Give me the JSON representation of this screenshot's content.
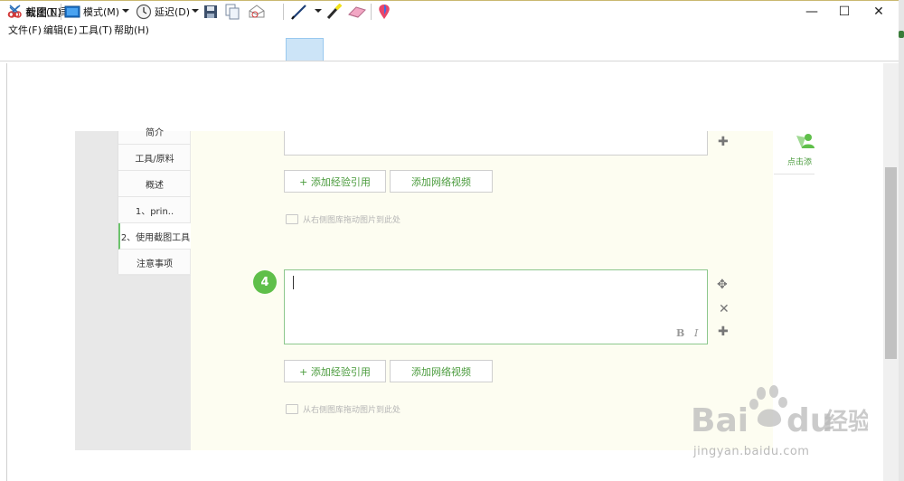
{
  "window": {
    "title": "截图工具",
    "controls": {
      "minimize": "—",
      "maximize": "☐",
      "close": "✕"
    }
  },
  "menu": [
    "文件(F)",
    "编辑(E)",
    "工具(T)",
    "帮助(H)"
  ],
  "toolbar": {
    "new_label": "新建(N)",
    "mode_label": "模式(M)",
    "delay_label": "延迟(D)"
  },
  "sidebar": {
    "items": [
      "简介",
      "工具/原料",
      "概述",
      "1、prin..",
      "2、使用截图工具",
      "注意事项"
    ],
    "active_index": 4
  },
  "editor": {
    "add_experience_label": "+ 添加经验引用",
    "add_video_label": "添加网络视频",
    "drag_hint": "从右侧图库拖动图片到此处",
    "step_number": "4",
    "bold_label": "B",
    "italic_label": "I"
  },
  "right_panel": {
    "label": "点击添"
  },
  "watermark": {
    "logo": "Baidu经验",
    "domain": "jingyan.baidu.com"
  },
  "colors": {
    "accent_green": "#5fbf4a",
    "editor_bg": "#fdfdf1",
    "link_green": "#4a9b3c"
  }
}
